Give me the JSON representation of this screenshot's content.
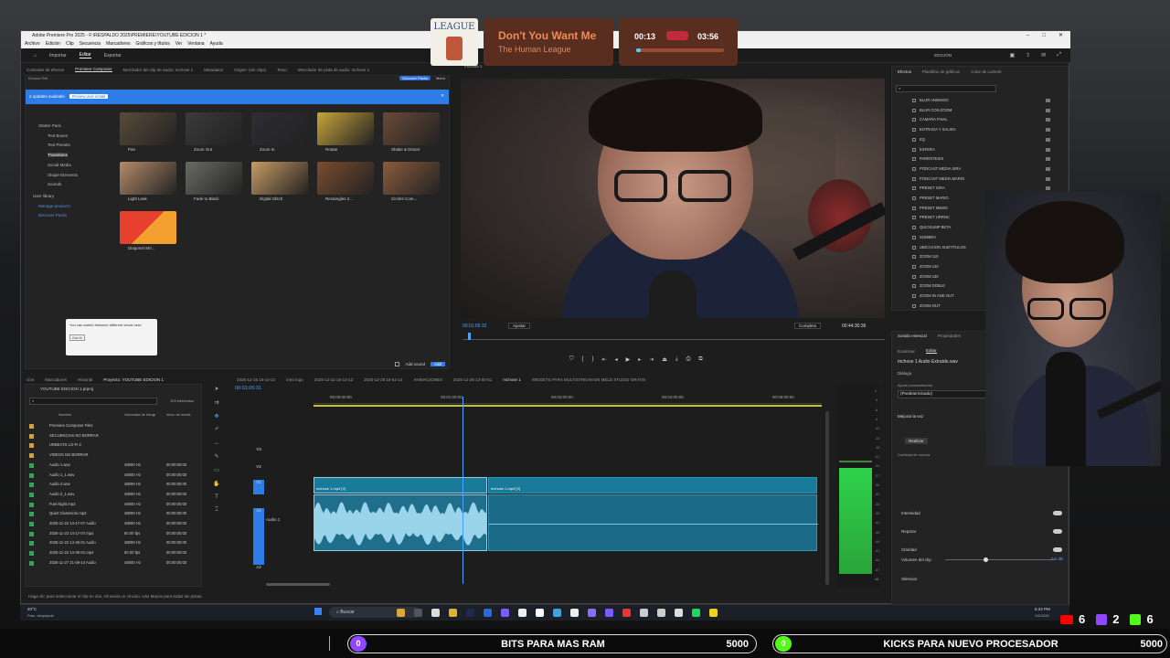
{
  "window": {
    "title": "Adobe Premiere Pro 2025 - F:\\RESPALDO 2025\\PREMIERE\\YOUTUBE EDICION 1 *",
    "menu": [
      "Archivo",
      "Edición",
      "Clip",
      "Secuencia",
      "Marcadores",
      "Gráficos y títulos",
      "Ver",
      "Ventana",
      "Ayuda"
    ],
    "workspaces": [
      "Importar",
      "Editar",
      "Exportar"
    ],
    "workspace_right": "EDICIÓN"
  },
  "music": {
    "title": "Don't You Want Me",
    "artist": "The Human League",
    "elapsed": "00:13",
    "total": "03:56",
    "progress_fraction": 0.055,
    "cover_text": "LEAGUE"
  },
  "panel_tabs": {
    "top_left": [
      "Controles de efectos",
      "Premiere Composer",
      "Mezclador del clip de audio: mchose 1",
      "Metadatos",
      "Origen: (sin clips)",
      "Texto",
      "Mezclador de pista de audio: mchose 1"
    ],
    "program_tab": "mchose 1"
  },
  "composer": {
    "updates": "2 updates available",
    "review_button": "Review and install",
    "discover_button": "Discover Packs",
    "menu": "Menu",
    "side_tabs": [
      "Browse",
      "Edit"
    ],
    "tree": [
      "Starter Pack",
      "Text Boxes",
      "Text Presets",
      "Transitions",
      "Social Media",
      "Shape Elements",
      "Sounds",
      "User library",
      "Manage products",
      "Discover Packs"
    ],
    "items": [
      {
        "label": "Pan",
        "color": "#5a4a3a"
      },
      {
        "label": "Zoom Out",
        "color": "#3a3a3a"
      },
      {
        "label": "Zoom In",
        "color": "#2d2d33"
      },
      {
        "label": "Rotate",
        "color": "#c7a43a"
      },
      {
        "label": "Shake & Distort",
        "color": "#6a4a38"
      },
      {
        "label": "Light Leak",
        "color": "#b58a6a"
      },
      {
        "label": "Fade to Black",
        "color": "#6a6a64"
      },
      {
        "label": "Digital Glitch",
        "color": "#c89b64"
      },
      {
        "label": "Rectangles 2...",
        "color": "#7a4c2e"
      },
      {
        "label": "Circles Com...",
        "color": "#8a5c3e"
      },
      {
        "label": "Diagonal Stri...",
        "color": "#e65a2e"
      }
    ],
    "tooltip": "You can switch between different views here.",
    "tooltip_button": "Got it!",
    "add_sound": "Add sound",
    "add_button": "Add"
  },
  "program": {
    "timecode": "00:01:05:32",
    "fit": "Ajustar",
    "quality": "Completo",
    "duration": "00:44:30:36"
  },
  "effects": {
    "tabs": [
      "Efectos",
      "Plantillas de gráficos",
      "Color de Lumetri"
    ],
    "items": [
      "BLUR ANIMADO",
      "BLUR CON ZOOM",
      "CAMARA FINAL",
      "ENTRADA Y SALIDA",
      "EQ",
      "ESFERA",
      "PARENTESIS",
      "PODCAST MEDIA ISRA",
      "PODCAST MEDIA MARIO",
      "PRESET ISRA",
      "PRESET MARIO",
      "PRESET MEMO",
      "PRESET URRNC",
      "QUICKUMP BETA",
      "SOMBRA",
      "UBICACION SUBTITULOS",
      "ZOOM 110",
      "ZOOM 120",
      "ZOOM 130",
      "ZOOM DOBLE",
      "ZOOM IN AND OUT",
      "ZOOM OUT"
    ]
  },
  "essential_sound": {
    "tabs": [
      "Sonido esencial",
      "Propiedades"
    ],
    "subtabs": [
      "Examinar",
      "Editar"
    ],
    "clip": "mchose 1 Audio Extraído.wav",
    "type": "Diálogo",
    "preset_label": "Ajuste preestablecido",
    "preset": "(Predeterminado)",
    "enhance": "Mejorar la voz",
    "apply": "Realizar",
    "amount": "Cantidad de mezcla",
    "repair_rows": [
      "Intensidad",
      "Reparar",
      "Claridad"
    ],
    "volume": "Volumen del clip",
    "volume_val": "0.0 dB",
    "mute": "Silenciar"
  },
  "project": {
    "tabs": [
      "ción",
      "Marcadores",
      "Historial",
      "Proyecto: YOUTUBE EDICION 1"
    ],
    "file": "YOUTUBE EDICION 1.prproj",
    "count": "109 elementos",
    "headers": [
      "Nombre",
      "Velocidad de fotogr",
      "Inicio de medic"
    ],
    "rows": [
      {
        "name": "Premiere Composer Files",
        "rate": "",
        "start": "",
        "folder": true
      },
      {
        "name": "SECUENCIAS NO BORRAR",
        "rate": "",
        "start": "",
        "folder": true
      },
      {
        "name": "URBEATS LO-FI 2",
        "rate": "",
        "start": "",
        "folder": true
      },
      {
        "name": "VIDEOS NO BORRAR",
        "rate": "",
        "start": "",
        "folder": true
      },
      {
        "name": "Audio 1.wav",
        "rate": "48000 Hz",
        "start": "00:00:00:00"
      },
      {
        "name": "Audio 1_1.wav",
        "rate": "48000 Hz",
        "start": "00:00:00:00"
      },
      {
        "name": "Audio 2.wav",
        "rate": "48000 Hz",
        "start": "00:00:00:00"
      },
      {
        "name": "Audio 2_1.wav",
        "rate": "48000 Hz",
        "start": "00:00:00:00"
      },
      {
        "name": "Fuel Night.mp3",
        "rate": "48000 Hz",
        "start": "00:00:00:00"
      },
      {
        "name": "Quiet Classroom.mp3",
        "rate": "48000 Hz",
        "start": "00:00:00:00"
      },
      {
        "name": "2025-11-22 14-17-07 Audio",
        "rate": "48000 Hz",
        "start": "00:00:00:00"
      },
      {
        "name": "2025-11-22 14-17-07.mp4",
        "rate": "60.00 fps",
        "start": "00:00:00:00"
      },
      {
        "name": "2025-11-22 14-36-01 Audio",
        "rate": "48000 Hz",
        "start": "00:00:00:00"
      },
      {
        "name": "2025-11-22 14-36-01.mp4",
        "rate": "60.00 fps",
        "start": "00:00:00:00"
      },
      {
        "name": "2025-11-27 21-08-14 Audio",
        "rate": "48000 Hz",
        "start": "00:00:00:00"
      }
    ]
  },
  "timeline": {
    "tabs": [
      "2025-12-15 15-14-21",
      "intro logo",
      "2025-12-22 16-13-12",
      "2025-12-28 18-52-14",
      "ANIMACIONES",
      "2025-12-26 13-00-51",
      "mchose 1",
      "WIDGETS PARA MULTISTREAM EN MELD STUDIO GRATIS"
    ],
    "timecode": "00:01:05:31",
    "ruler": [
      "00:00:00:00",
      "00:01:00:00",
      "00:03:00:00",
      "00:04:00:00",
      "00:05:00:00"
    ],
    "tracks": [
      "V3",
      "V2",
      "V1",
      "A1",
      "A2"
    ],
    "audio_label": "Audio 1",
    "clip1": "mchose 1.mp4 [V]",
    "clip2": "mchose 1.mp4 [V]"
  },
  "meter": {
    "labels": [
      "0",
      "-3",
      "-6",
      "-9",
      "-12",
      "-15",
      "-18",
      "-21",
      "-24",
      "-27",
      "-30",
      "-33",
      "-36",
      "-39",
      "-42",
      "-45",
      "-48",
      "-51",
      "-54",
      "-57",
      "dB"
    ]
  },
  "status": "Haga clic para seleccionar el clip en dos. Alt anula un vínculo. Use Mayús para todas las pistas.",
  "taskbar": {
    "weather": "20°C",
    "weather_desc": "Prac. despejado",
    "search": "Buscar",
    "time": "6:24 PM",
    "date": "1/6/2026"
  },
  "stream": {
    "youtube": "6",
    "twitch": "2",
    "kick": "6",
    "goal1": {
      "label": "BITS PARA MAS RAM",
      "current": "0",
      "target": "5000",
      "color": "#9146ff"
    },
    "goal2": {
      "label": "KICKS PARA NUEVO PROCESADOR",
      "current": "0",
      "target": "5000",
      "color": "#53fc18"
    }
  }
}
